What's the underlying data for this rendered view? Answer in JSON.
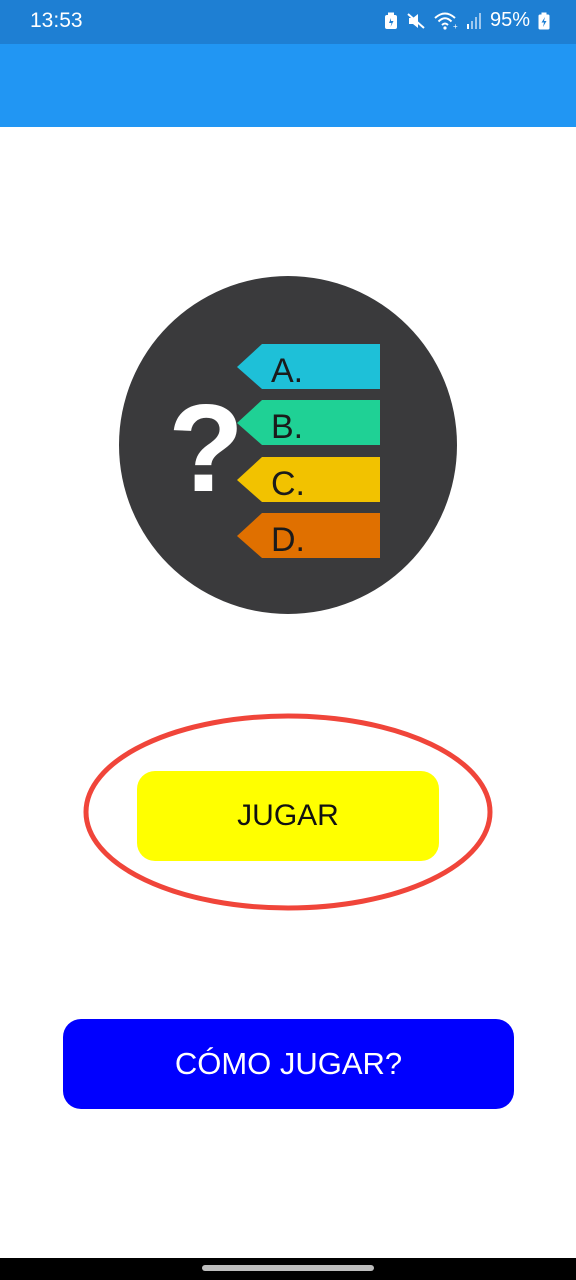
{
  "status_bar": {
    "time": "13:53",
    "battery_percent": "95%",
    "icons": [
      "battery-saver-icon",
      "mute-icon",
      "wifi-icon",
      "signal-icon",
      "battery-charging-icon"
    ]
  },
  "logo": {
    "question_mark": "?",
    "options": [
      {
        "label": "A.",
        "color": "#1ec0d8"
      },
      {
        "label": "B.",
        "color": "#1fd195"
      },
      {
        "label": "C.",
        "color": "#f2c200"
      },
      {
        "label": "D.",
        "color": "#e07000"
      }
    ],
    "circle_color": "#3a3a3c"
  },
  "buttons": {
    "play_label": "JUGAR",
    "how_to_play_label": "CÓMO JUGAR?"
  },
  "colors": {
    "status_bar": "#1e7fd3",
    "app_bar": "#2196f3",
    "play_button": "#ffff00",
    "how_to_button": "#0000ff",
    "highlight": "#f0453a"
  }
}
